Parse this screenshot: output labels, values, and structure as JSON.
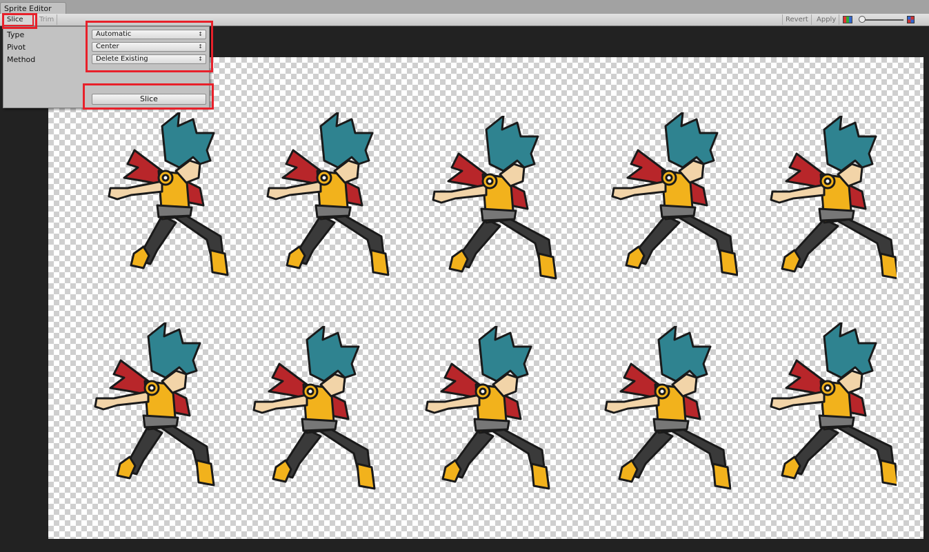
{
  "window": {
    "tab_title": "Sprite Editor"
  },
  "toolbar": {
    "slice_label": "Slice ÷",
    "trim_label": "Trim",
    "revert_label": "Revert",
    "apply_label": "Apply"
  },
  "slice_popup": {
    "fields": [
      {
        "label": "Type",
        "value": "Automatic"
      },
      {
        "label": "Pivot",
        "value": "Center"
      },
      {
        "label": "Method",
        "value": "Delete Existing"
      }
    ],
    "slice_button_label": "Slice"
  },
  "colors": {
    "highlight": "#e8202a",
    "hair": "#2f8390",
    "scarf": "#b8262a",
    "armor": "#f2b21c",
    "pants": "#3a3a3a",
    "skin": "#f2d4a8"
  },
  "sprite_sheet": {
    "rows": 2,
    "columns": 5,
    "frame_count": 10
  }
}
